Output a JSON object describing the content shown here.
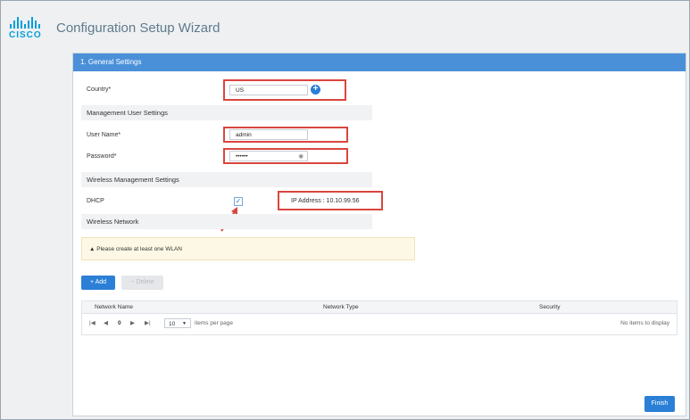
{
  "header": {
    "logo_text": "CISCO",
    "title": "Configuration Setup Wizard"
  },
  "panel": {
    "title": "1. General Settings"
  },
  "form": {
    "country_label": "Country*",
    "country_value": "US",
    "mgmt_section": "Management User Settings",
    "username_label": "User Name*",
    "username_value": "admin",
    "password_label": "Password*",
    "password_value": "••••••",
    "wireless_mgmt_section": "Wireless Management Settings",
    "dhcp_label": "DHCP",
    "dhcp_checked": true,
    "ip_address_text": "IP Address : 10.10.99.56",
    "wireless_network_section": "Wireless Network"
  },
  "warning": {
    "icon": "warning-triangle-icon",
    "text": "Please create at least one WLAN"
  },
  "buttons": {
    "add": "+ Add",
    "delete": "− Delete",
    "finish": "Finish"
  },
  "table": {
    "columns": [
      "Network Name",
      "Network Type",
      "Security"
    ],
    "empty_text": "No items to display",
    "current_page": "0",
    "per_page": "10",
    "per_page_label": "items per page",
    "nav_first": "|◀",
    "nav_prev": "◀",
    "nav_next": "▶",
    "nav_last": "▶|"
  },
  "colors": {
    "brand": "#049fd9",
    "panel_header": "#4a90d9",
    "primary_button": "#2b7fd6",
    "highlight_box": "#d9463e",
    "warning_bg": "#fdf8e6"
  }
}
